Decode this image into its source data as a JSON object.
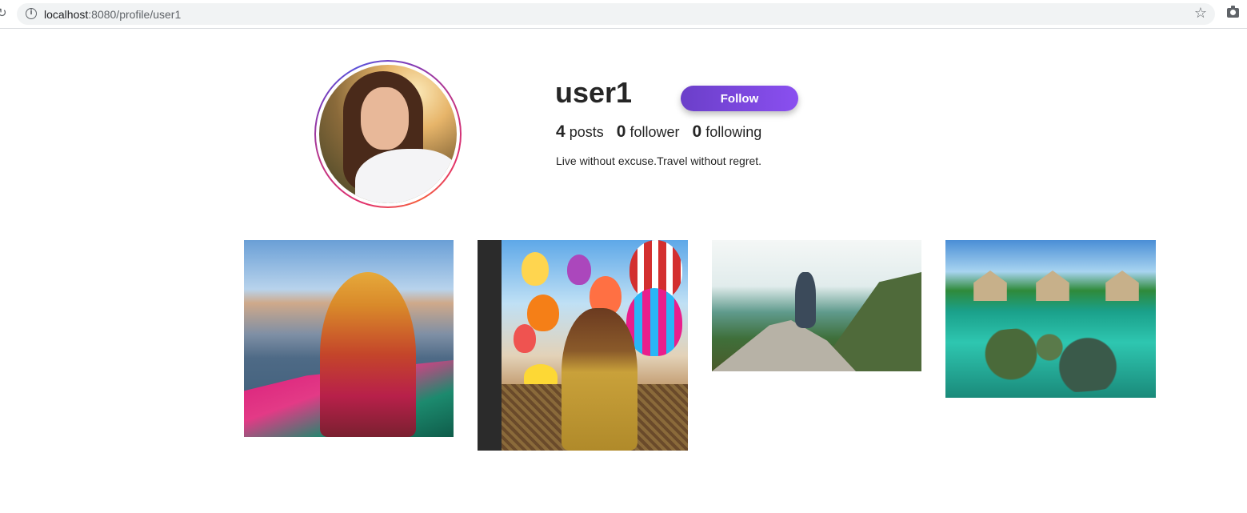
{
  "browser": {
    "url_host": "localhost",
    "url_rest": ":8080/profile/user1",
    "info_symbol": "i"
  },
  "profile": {
    "username": "user1",
    "follow_label": "Follow",
    "stats": {
      "posts_count": "4",
      "posts_label": "posts",
      "followers_count": "0",
      "followers_label": "follower",
      "following_count": "0",
      "following_label": "following"
    },
    "bio": "Live without excuse.Travel without regret."
  },
  "posts": [
    {
      "subject": "woman in red sari in boat on river"
    },
    {
      "subject": "woman in hot air balloon basket among balloons"
    },
    {
      "subject": "hiker on mountain cliff"
    },
    {
      "subject": "tropical overwater huts and turquoise reef"
    }
  ],
  "colors": {
    "follow_button_start": "#6b3fc9",
    "follow_button_end": "#8a4ff0",
    "text": "#262626",
    "avatar_ring": "#c13584"
  }
}
